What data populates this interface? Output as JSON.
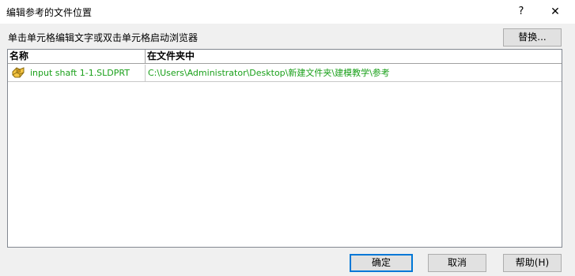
{
  "window": {
    "title": "编辑参考的文件位置",
    "help_label": "?",
    "close_label": "✕"
  },
  "instruction": "单击单元格编辑文字或双击单元格启动浏览器",
  "replace_button": "替换...",
  "table": {
    "columns": [
      "名称",
      "在文件夹中"
    ],
    "rows": [
      {
        "name": "input shaft 1-1.SLDPRT",
        "folder": "C:\\Users\\Administrator\\Desktop\\新建文件夹\\建模教学\\参考",
        "icon": "sldprt-part-icon",
        "text_color": "#1aa01a"
      }
    ]
  },
  "buttons": {
    "ok": "确定",
    "cancel": "取消",
    "help": "帮助(H)"
  }
}
